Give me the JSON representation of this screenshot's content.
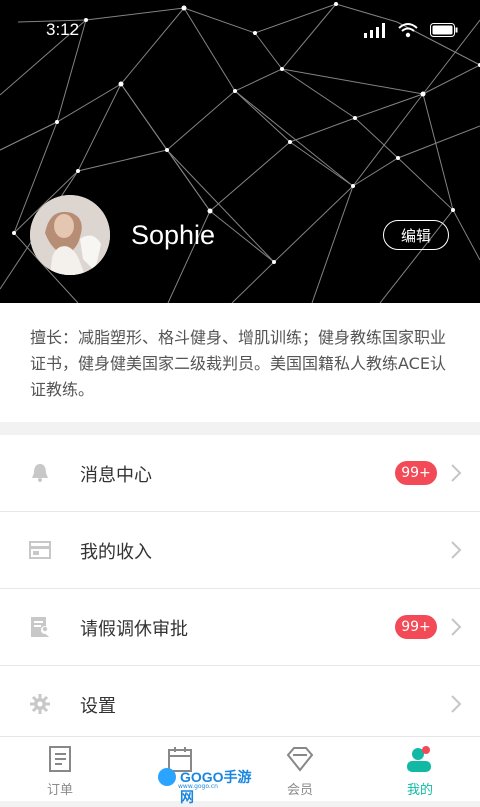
{
  "status": {
    "time": "3:12"
  },
  "profile": {
    "name": "Sophie",
    "edit_label": "编辑"
  },
  "bio": "擅长：减脂塑形、格斗健身、增肌训练；健身教练国家职业证书，健身健美国家二级裁判员。美国国籍私人教练ACE认证教练。",
  "menu": {
    "items": [
      {
        "label": "消息中心",
        "badge": "99+",
        "icon": "bell-icon"
      },
      {
        "label": "我的收入",
        "badge": "",
        "icon": "card-icon"
      },
      {
        "label": "请假调休审批",
        "badge": "99+",
        "icon": "document-person-icon"
      },
      {
        "label": "设置",
        "badge": "",
        "icon": "gear-icon"
      }
    ]
  },
  "tabs": [
    {
      "label": "订单",
      "icon": "order-icon",
      "active": false
    },
    {
      "label": "",
      "icon": "calendar-icon",
      "active": false
    },
    {
      "label": "会员",
      "icon": "diamond-icon",
      "active": false
    },
    {
      "label": "我的",
      "icon": "profile-icon",
      "active": true
    }
  ],
  "watermark": {
    "brand": "GOGO手游网",
    "subtitle": "www.gogo.cn"
  },
  "colors": {
    "accent": "#11b9a5",
    "badge": "#f24a56",
    "hero": "#000000"
  }
}
